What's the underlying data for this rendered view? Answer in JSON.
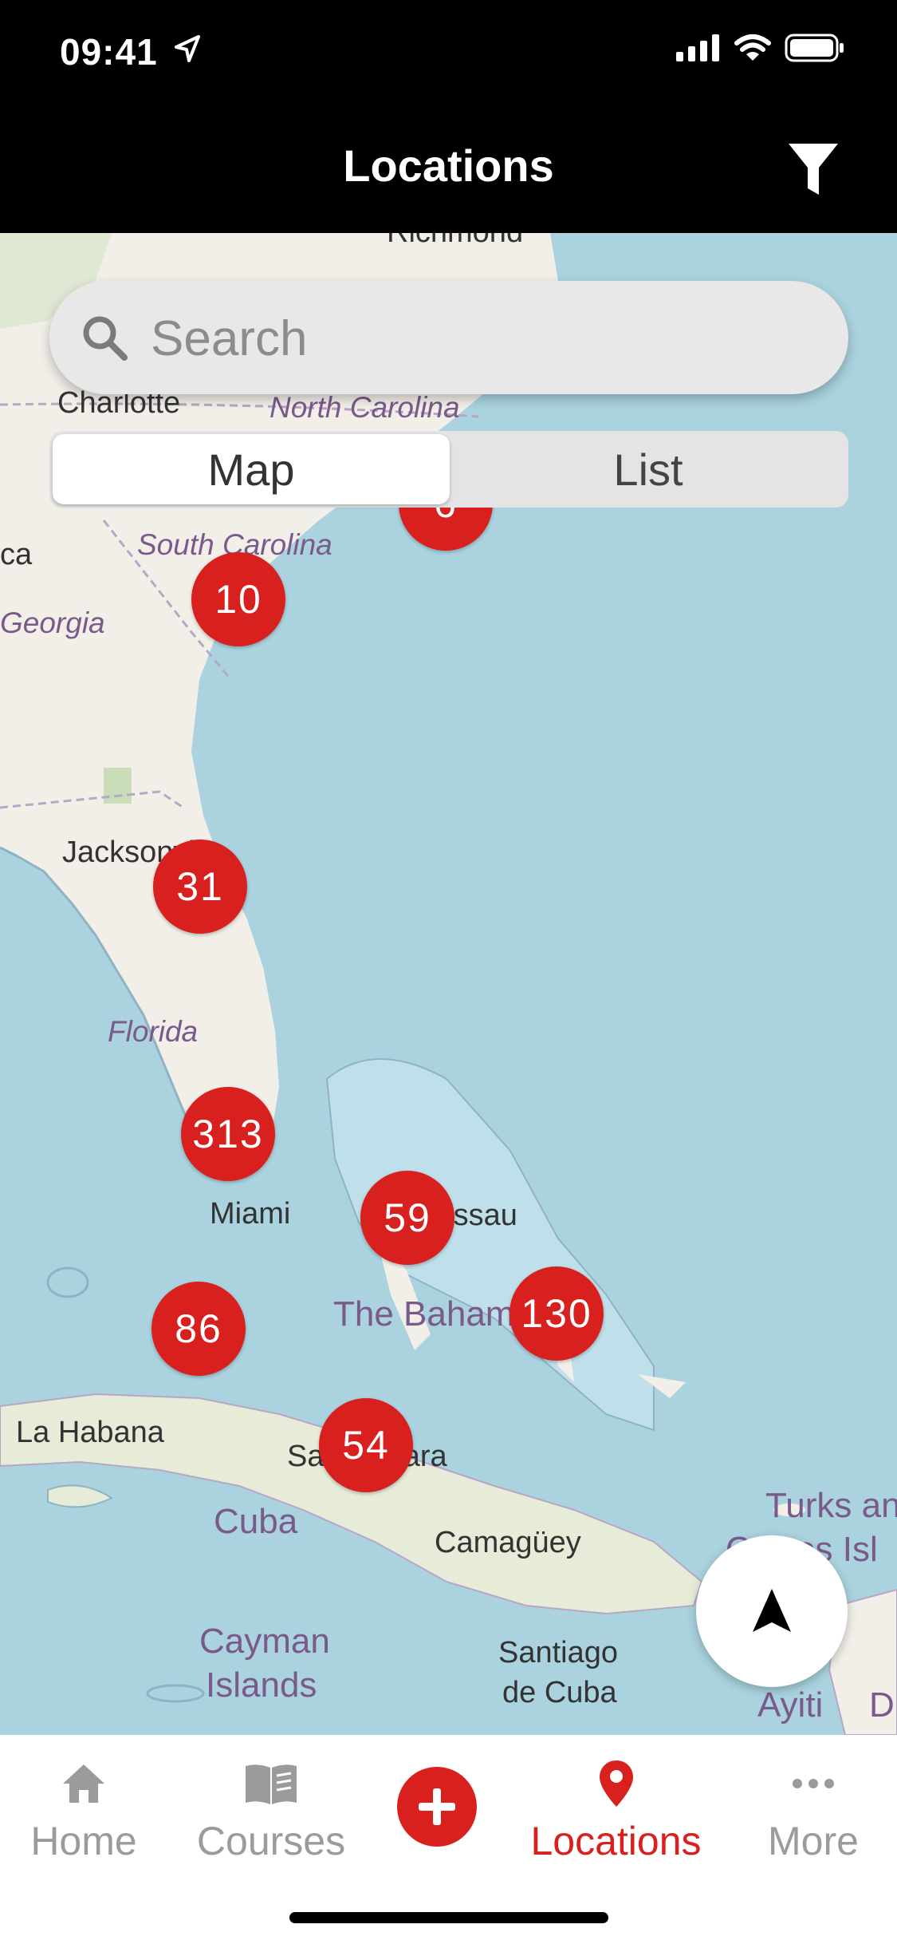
{
  "status_bar": {
    "time": "09:41"
  },
  "nav": {
    "title": "Locations",
    "filter_icon": "filter-icon"
  },
  "search": {
    "placeholder": "Search"
  },
  "view_toggle": {
    "map_label": "Map",
    "list_label": "List",
    "selected": "Map"
  },
  "map": {
    "place_labels": {
      "richmond": "Richmond",
      "charlotte": "Charlotte",
      "north_carolina": "North Carolina",
      "south_carolina": "South Carolina",
      "georgia": "Georgia",
      "ca": "ca",
      "jacksonville": "Jacksonville",
      "florida": "Florida",
      "miami": "Miami",
      "nassau": "Nassau",
      "the_bahamas": "The Bahamas",
      "la_habana": "La Habana",
      "santa_clara": "Santa Clara",
      "cuba": "Cuba",
      "camaguey": "Camagüey",
      "cayman": "Cayman",
      "islands": "Islands",
      "santiago": "Santiago",
      "de_cuba": "de Cuba",
      "turks": "Turks and",
      "caicos": "Caicos Isl",
      "ayiti": "Ayiti",
      "d": "D"
    },
    "clusters": [
      {
        "id": "nc",
        "count": "6"
      },
      {
        "id": "sc",
        "count": "10"
      },
      {
        "id": "jax",
        "count": "31"
      },
      {
        "id": "fl",
        "count": "313"
      },
      {
        "id": "nassau",
        "count": "59"
      },
      {
        "id": "bahamas",
        "count": "130"
      },
      {
        "id": "keys",
        "count": "86"
      },
      {
        "id": "cuba",
        "count": "54"
      }
    ]
  },
  "tabbar": {
    "home": "Home",
    "courses": "Courses",
    "locations": "Locations",
    "more": "More",
    "active": "Locations"
  },
  "colors": {
    "accent": "#d8201e",
    "water": "#aad3df",
    "land": "#f2efe9"
  }
}
